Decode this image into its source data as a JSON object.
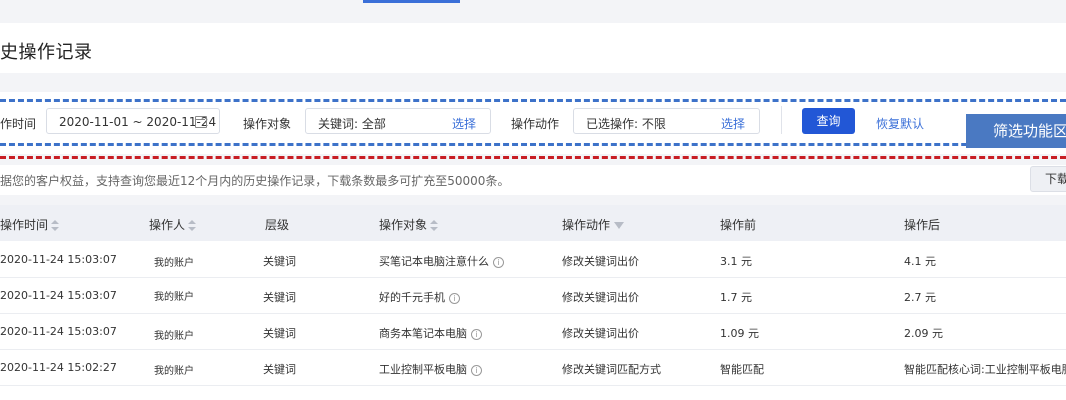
{
  "page": {
    "title": "史操作记录"
  },
  "filters": {
    "time_label": "作时间",
    "date_range": "2020-11-01 ~ 2020-11-24",
    "object_label": "操作对象",
    "object_value": "关键词: 全部",
    "object_select": "选择",
    "action_label": "操作动作",
    "action_value": "已选操作: 不限",
    "action_select": "选择",
    "query_button": "查询",
    "reset_button": "恢复默认"
  },
  "annotation": {
    "callout": "筛选功能区"
  },
  "notice": {
    "text": "据您的客户权益，支持查询您最近12个月内的历史操作记录，下载条数最多可扩充至50000条。",
    "download_button": "下载"
  },
  "table": {
    "headers": {
      "time": "操作时间",
      "operator": "操作人",
      "level": "层级",
      "object": "操作对象",
      "action": "操作动作",
      "before": "操作前",
      "after": "操作后"
    },
    "rows": [
      {
        "time": "2020-11-24 15:03:07",
        "operator": "我的账户",
        "level": "关键词",
        "object": "买笔记本电脑注意什么",
        "action": "修改关键词出价",
        "before": "3.1 元",
        "after": "4.1 元"
      },
      {
        "time": "2020-11-24 15:03:07",
        "operator": "我的账户",
        "level": "关键词",
        "object": "好的千元手机",
        "action": "修改关键词出价",
        "before": "1.7 元",
        "after": "2.7 元"
      },
      {
        "time": "2020-11-24 15:03:07",
        "operator": "我的账户",
        "level": "关键词",
        "object": "商务本笔记本电脑",
        "action": "修改关键词出价",
        "before": "1.09 元",
        "after": "2.09 元"
      },
      {
        "time": "2020-11-24 15:02:27",
        "operator": "我的账户",
        "level": "关键词",
        "object": "工业控制平板电脑",
        "action": "修改关键词匹配方式",
        "before": "智能匹配",
        "after": "智能匹配核心词:工业控制平板电脑"
      }
    ]
  },
  "colors": {
    "primary": "#2257d6",
    "link": "#3a6fd8",
    "dash_blue": "#3d72c9",
    "dash_red": "#c81d24",
    "callout_bg": "#4a79c2"
  }
}
